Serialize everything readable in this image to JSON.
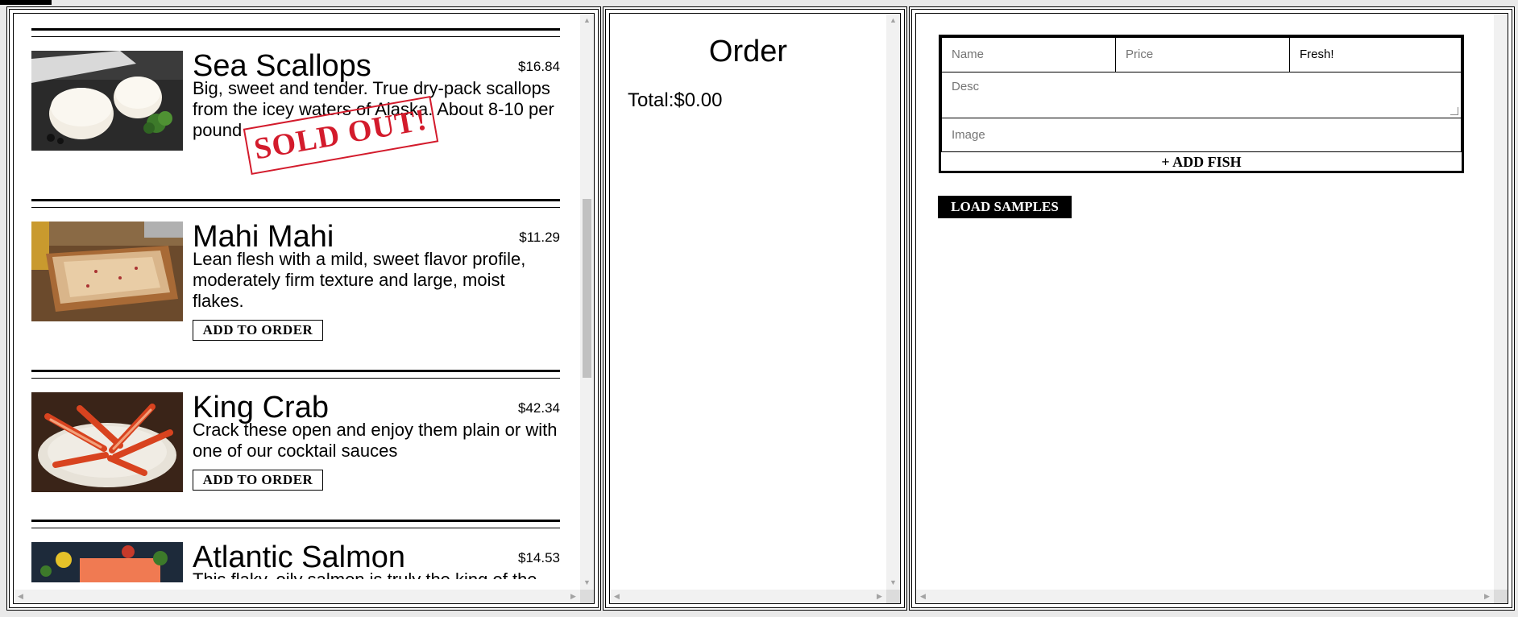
{
  "menu": {
    "items": [
      {
        "name": "Sea Scallops",
        "price": "$16.84",
        "desc": "Big, sweet and tender. True dry-pack scallops from the icey waters of Alaska. About 8-10 per pound",
        "sold_out": true,
        "stamp": "SOLD OUT!",
        "image": "scallops-photo"
      },
      {
        "name": "Mahi Mahi",
        "price": "$11.29",
        "desc": "Lean flesh with a mild, sweet flavor profile, moderately firm texture and large, moist flakes.",
        "button": "ADD TO ORDER",
        "image": "mahi-photo"
      },
      {
        "name": "King Crab",
        "price": "$42.34",
        "desc": "Crack these open and enjoy them plain or with one of our cocktail sauces",
        "button": "ADD TO ORDER",
        "image": "crab-photo"
      },
      {
        "name": "Atlantic Salmon",
        "price": "$14.53",
        "desc": "This flaky, oily salmon is truly the king of the",
        "image": "salmon-photo"
      }
    ]
  },
  "order": {
    "title": "Order",
    "total": "Total:$0.00"
  },
  "inventory": {
    "name_placeholder": "Name",
    "price_placeholder": "Price",
    "status_value": "Fresh!",
    "desc_placeholder": "Desc",
    "image_placeholder": "Image",
    "add_label": "+ ADD FISH",
    "load_label": "LOAD SAMPLES"
  },
  "colors": {
    "stamp": "#d31b2c",
    "border": "#000000",
    "scrollbar": "#f1f1f1"
  }
}
